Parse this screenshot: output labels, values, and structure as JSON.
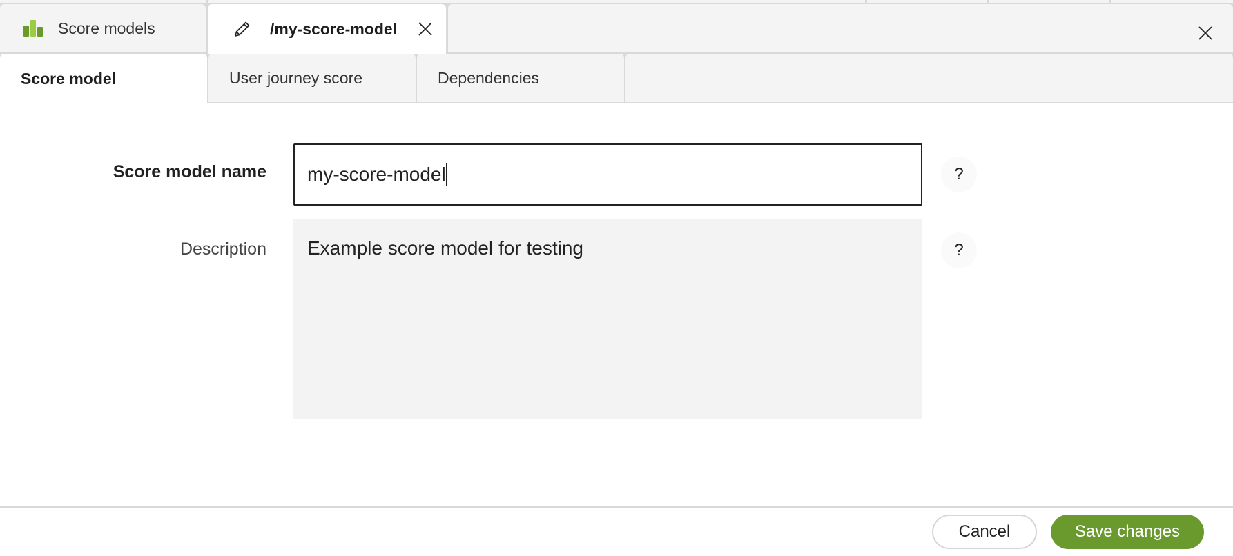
{
  "tabs": {
    "top": [
      {
        "label": "Score models",
        "icon": "bar-chart-icon",
        "active": false
      },
      {
        "label": "/my-score-model",
        "icon": "pencil-icon",
        "active": true,
        "closable": true
      }
    ],
    "sub": [
      {
        "label": "Score model",
        "active": true
      },
      {
        "label": "User journey score",
        "active": false
      },
      {
        "label": "Dependencies",
        "active": false
      }
    ]
  },
  "form": {
    "name": {
      "label": "Score model name",
      "value": "my-score-model",
      "help": "?"
    },
    "description": {
      "label": "Description",
      "value": "Example score model for testing",
      "help": "?"
    }
  },
  "footer": {
    "cancel_label": "Cancel",
    "save_label": "Save changes"
  },
  "colors": {
    "accent": "#6a9a2e",
    "icon_dark_green": "#6a9a2c",
    "icon_light_green": "#9ccc44"
  }
}
